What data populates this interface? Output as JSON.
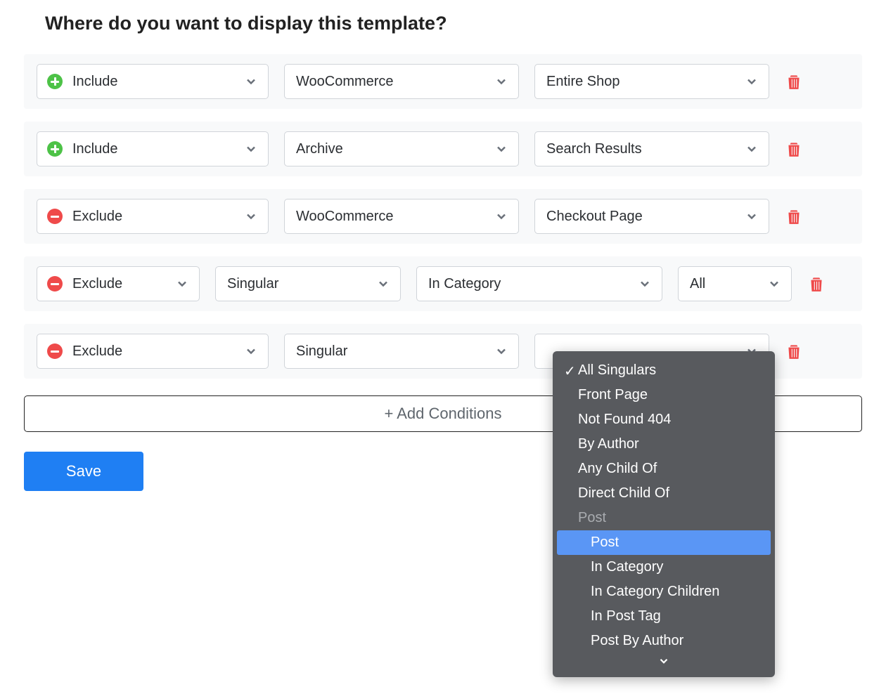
{
  "title": "Where do you want to display this template?",
  "conditions": [
    {
      "mode": "Include",
      "icon": "plus",
      "fieldA": "WooCommerce",
      "fieldB": "Entire Shop",
      "layout": "three"
    },
    {
      "mode": "Include",
      "icon": "plus",
      "fieldA": "Archive",
      "fieldB": "Search Results",
      "layout": "three"
    },
    {
      "mode": "Exclude",
      "icon": "minus",
      "fieldA": "WooCommerce",
      "fieldB": "Checkout Page",
      "layout": "three"
    },
    {
      "mode": "Exclude",
      "icon": "minus",
      "fieldA": "Singular",
      "fieldB": "In Category",
      "fieldC": "All",
      "layout": "four"
    },
    {
      "mode": "Exclude",
      "icon": "minus",
      "fieldA": "Singular",
      "fieldB": "",
      "layout": "three",
      "dropdownOpen": true
    }
  ],
  "addConditions": "+ Add Conditions",
  "saveLabel": "Save",
  "dropdown": {
    "selected": "All Singulars",
    "items": [
      "Front Page",
      "Not Found 404",
      "By Author",
      "Any Child Of",
      "Direct Child Of"
    ],
    "groupLabel": "Post",
    "groupItems": [
      "Post",
      "In Category",
      "In Category Children",
      "In Post Tag",
      "Post By Author"
    ],
    "highlight": "Post"
  }
}
